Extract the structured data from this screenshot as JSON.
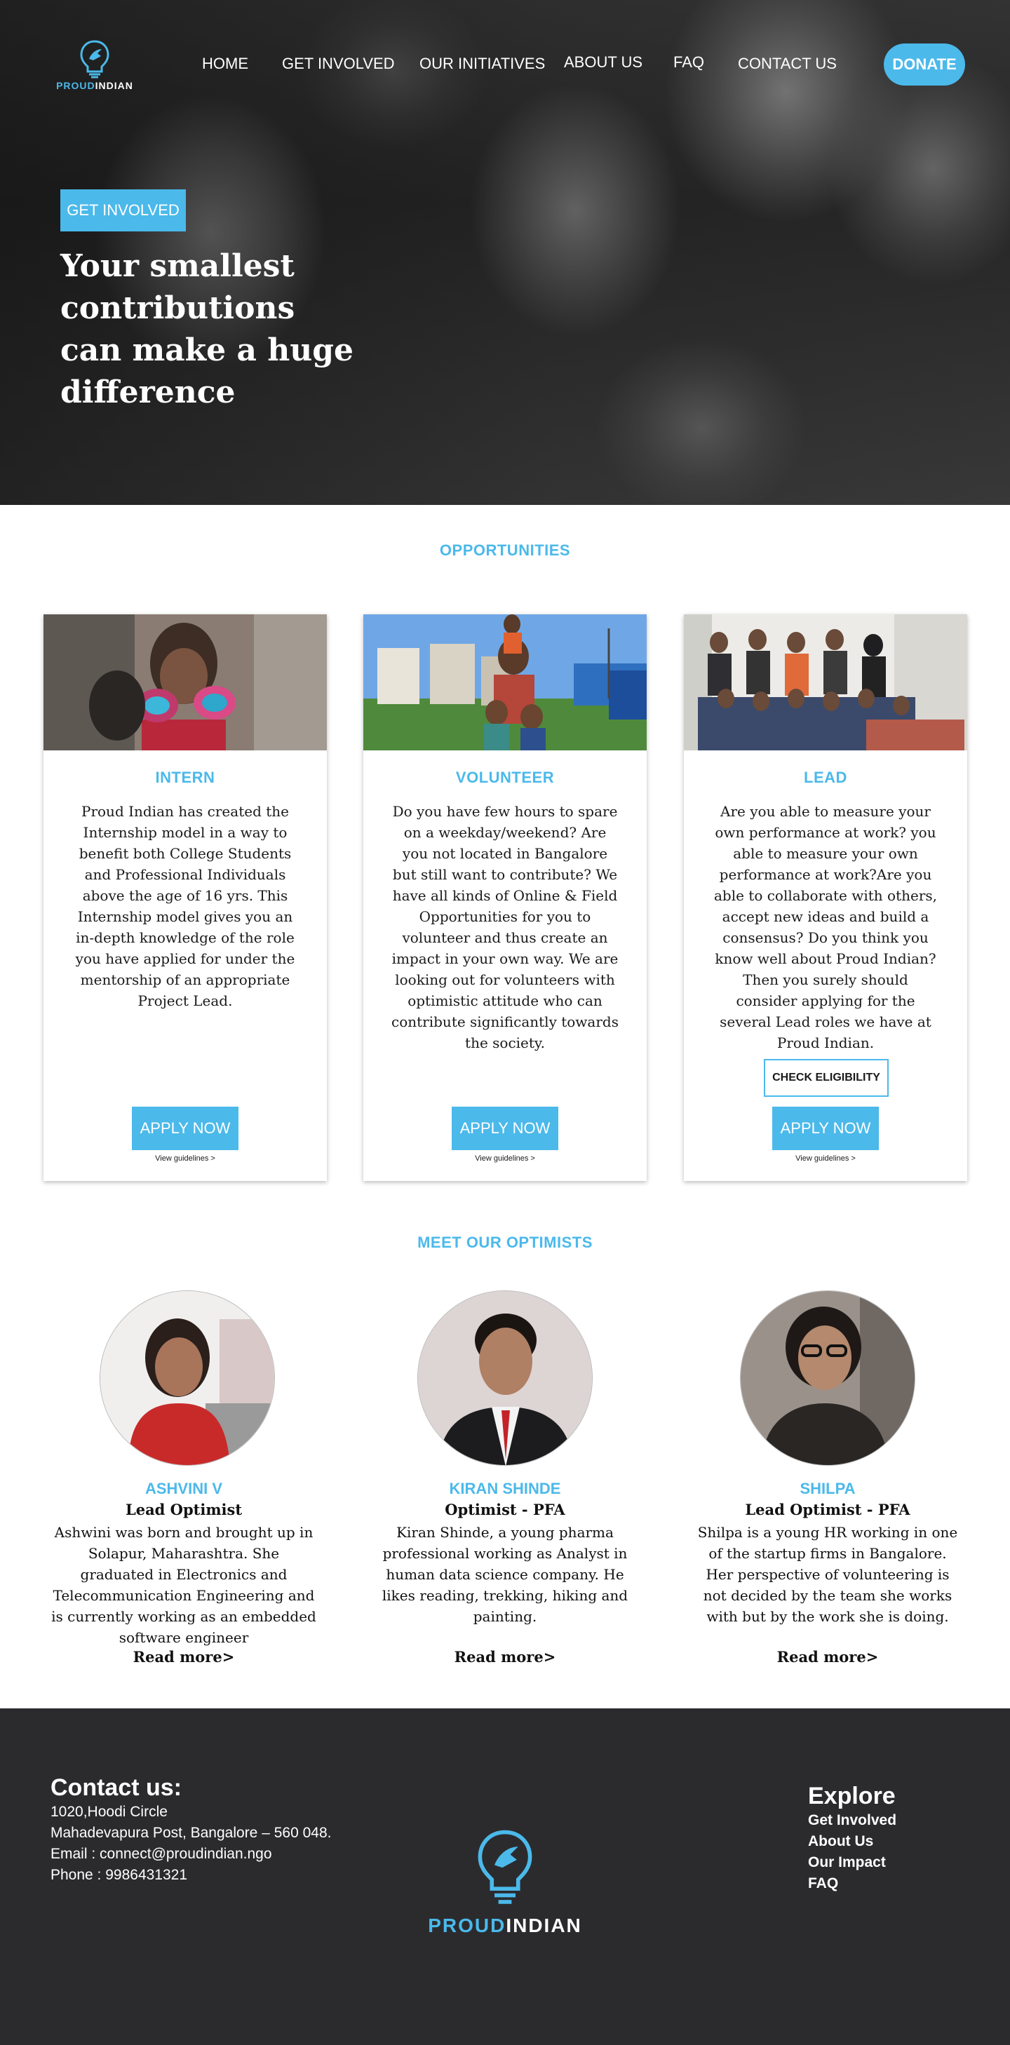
{
  "brand": {
    "logo_part1": "PROUD",
    "logo_part2": "INDIAN",
    "accent_color": "#4bb9ea",
    "footer_color": "#2b2b2e"
  },
  "nav": {
    "items": [
      "HOME",
      "GET INVOLVED",
      "OUR INITIATIVES",
      "ABOUT US",
      "FAQ",
      "CONTACT US"
    ],
    "donate_label": "DONATE"
  },
  "hero": {
    "tag_label": "GET INVOLVED",
    "title_line1": "Your smallest contributions",
    "title_line2": "can make a huge difference"
  },
  "opportunities": {
    "section_title": "OPPORTUNITIES",
    "cards": [
      {
        "title": "INTERN",
        "text": "Proud Indian has created the Internship model in a way to benefit both College Students and Professional Individuals above the age of 16 yrs. This Internship model gives you an in-depth knowledge of the role you have applied for under the mentorship of an appropriate Project Lead.",
        "apply_label": "APPLY NOW",
        "guidelines_label": "View guidelines >"
      },
      {
        "title": "VOLUNTEER",
        "text": "Do you have few hours to spare on a weekday/weekend? Are you not located in Bangalore but still want to contribute? We have all kinds of Online & Field Opportunities for you to volunteer and thus create an impact in your own way. We are looking out for volunteers with optimistic attitude who can contribute significantly towards the society.",
        "apply_label": "APPLY NOW",
        "guidelines_label": "View guidelines >"
      },
      {
        "title": "LEAD",
        "text": "Are you able to measure your own performance at work? you able to measure your own performance at work?Are you able to collaborate with others, accept new ideas and build a consensus? Do you think you know well about Proud Indian? Then you surely should consider applying for the several Lead roles we have at Proud Indian.",
        "check_label": "CHECK ELIGIBILITY",
        "apply_label": "APPLY NOW",
        "guidelines_label": "View guidelines >"
      }
    ]
  },
  "optimists": {
    "section_title": "MEET OUR OPTIMISTS",
    "people": [
      {
        "name": "ASHVINI V",
        "role": "Lead Optimist",
        "bio": "Ashwini was born and brought up in Solapur, Maharashtra. She graduated in Electronics and Telecommunication Engineering and is currently working as an embedded software engineer",
        "more": "Read more>"
      },
      {
        "name": "KIRAN SHINDE",
        "role": "Optimist - PFA",
        "bio": "Kiran Shinde, a young pharma professional working as Analyst in human data science company. He likes reading, trekking, hiking and painting.",
        "more": "Read more>"
      },
      {
        "name": "SHILPA",
        "role": "Lead Optimist - PFA",
        "bio": "Shilpa is a young HR working in one of the startup firms in Bangalore. Her perspective of volunteering is not decided by the team she works with but by the work she is doing.",
        "more": "Read more>"
      }
    ]
  },
  "footer": {
    "contact_title": "Contact us:",
    "address1": "1020,Hoodi Circle",
    "address2": "Mahadevapura Post, Bangalore – 560 048.",
    "email": "Email : connect@proudindian.ngo",
    "phone": "Phone : 9986431321",
    "explore_title": "Explore",
    "links": [
      "Get Involved",
      "About Us",
      "Our Impact",
      "FAQ"
    ]
  }
}
